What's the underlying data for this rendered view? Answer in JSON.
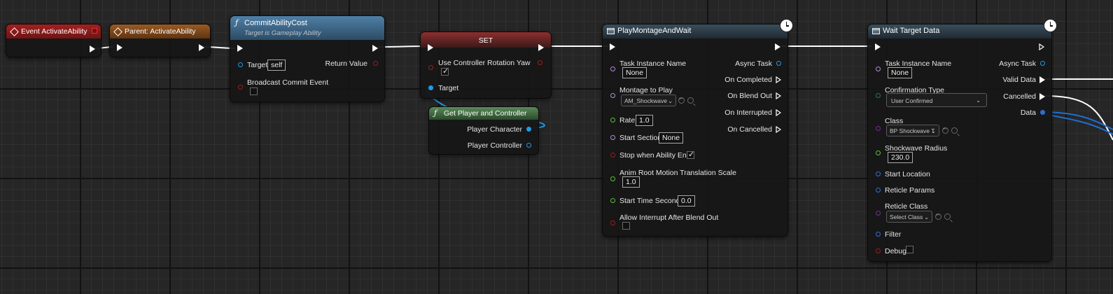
{
  "colors": {
    "exec": "#ffffff",
    "object": "#1e9be8",
    "bool": "#a41a1a",
    "name": "#b58ad8",
    "float": "#5ac03c",
    "struct": "#2f6fd0",
    "class": "#7b2a9a",
    "enum": "#1f7a5a",
    "event_header": "#8e1e1e",
    "parent_header": "#8a4a1e",
    "function_header": "#3c6586",
    "set_header": "#7a2a2a",
    "pure_header": "#3e6a3e",
    "task_header": "#2c3b47"
  },
  "event_node": {
    "title": "Event ActivateAbility",
    "icon": "event-diamond-icon"
  },
  "parent_node": {
    "title": "Parent: ActivateAbility",
    "icon": "event-diamond-icon"
  },
  "commit_node": {
    "title": "CommitAbilityCost",
    "subtitle": "Target is Gameplay Ability",
    "icon": "function-f-icon",
    "target_label": "Target",
    "target_value": "self",
    "broadcast_label": "Broadcast Commit Event",
    "return_label": "Return Value"
  },
  "set_node": {
    "title": "SET",
    "field_label": "Use Controller Rotation Yaw",
    "field_checked": true,
    "target_label": "Target"
  },
  "getplayer_node": {
    "title": "Get Player and Controller",
    "icon": "function-f-icon",
    "player_character": "Player Character",
    "player_controller": "Player Controller"
  },
  "montage_node": {
    "title": "PlayMontageAndWait",
    "icon": "task-icon",
    "task_instance_label": "Task Instance Name",
    "task_instance_value": "None",
    "montage_label": "Montage to Play",
    "montage_value": "AM_Shockwave",
    "rate_label": "Rate",
    "rate_value": "1.0",
    "start_section_label": "Start Section",
    "start_section_value": "None",
    "stop_label": "Stop when Ability Ends",
    "stop_checked": true,
    "anim_root_label": "Anim Root Motion Translation Scale",
    "anim_root_value": "1.0",
    "start_time_label": "Start Time Seconds",
    "start_time_value": "0.0",
    "allow_interrupt_label": "Allow Interrupt After Blend Out",
    "allow_interrupt_checked": false,
    "async_task": "Async Task",
    "on_completed": "On Completed",
    "on_blend_out": "On Blend Out",
    "on_interrupted": "On Interrupted",
    "on_cancelled": "On Cancelled"
  },
  "wait_node": {
    "title": "Wait Target Data",
    "icon": "task-icon",
    "task_instance_label": "Task Instance Name",
    "task_instance_value": "None",
    "confirmation_label": "Confirmation Type",
    "confirmation_value": "User Confirmed",
    "class_label": "Class",
    "class_value": "BP Shockwave T",
    "radius_label": "Shockwave Radius",
    "radius_value": "230.0",
    "start_location_label": "Start Location",
    "reticle_params_label": "Reticle Params",
    "reticle_class_label": "Reticle Class",
    "reticle_class_value": "Select Class",
    "filter_label": "Filter",
    "debug_label": "Debug",
    "debug_checked": false,
    "async_task": "Async Task",
    "valid_data": "Valid Data",
    "cancelled": "Cancelled",
    "data": "Data"
  }
}
